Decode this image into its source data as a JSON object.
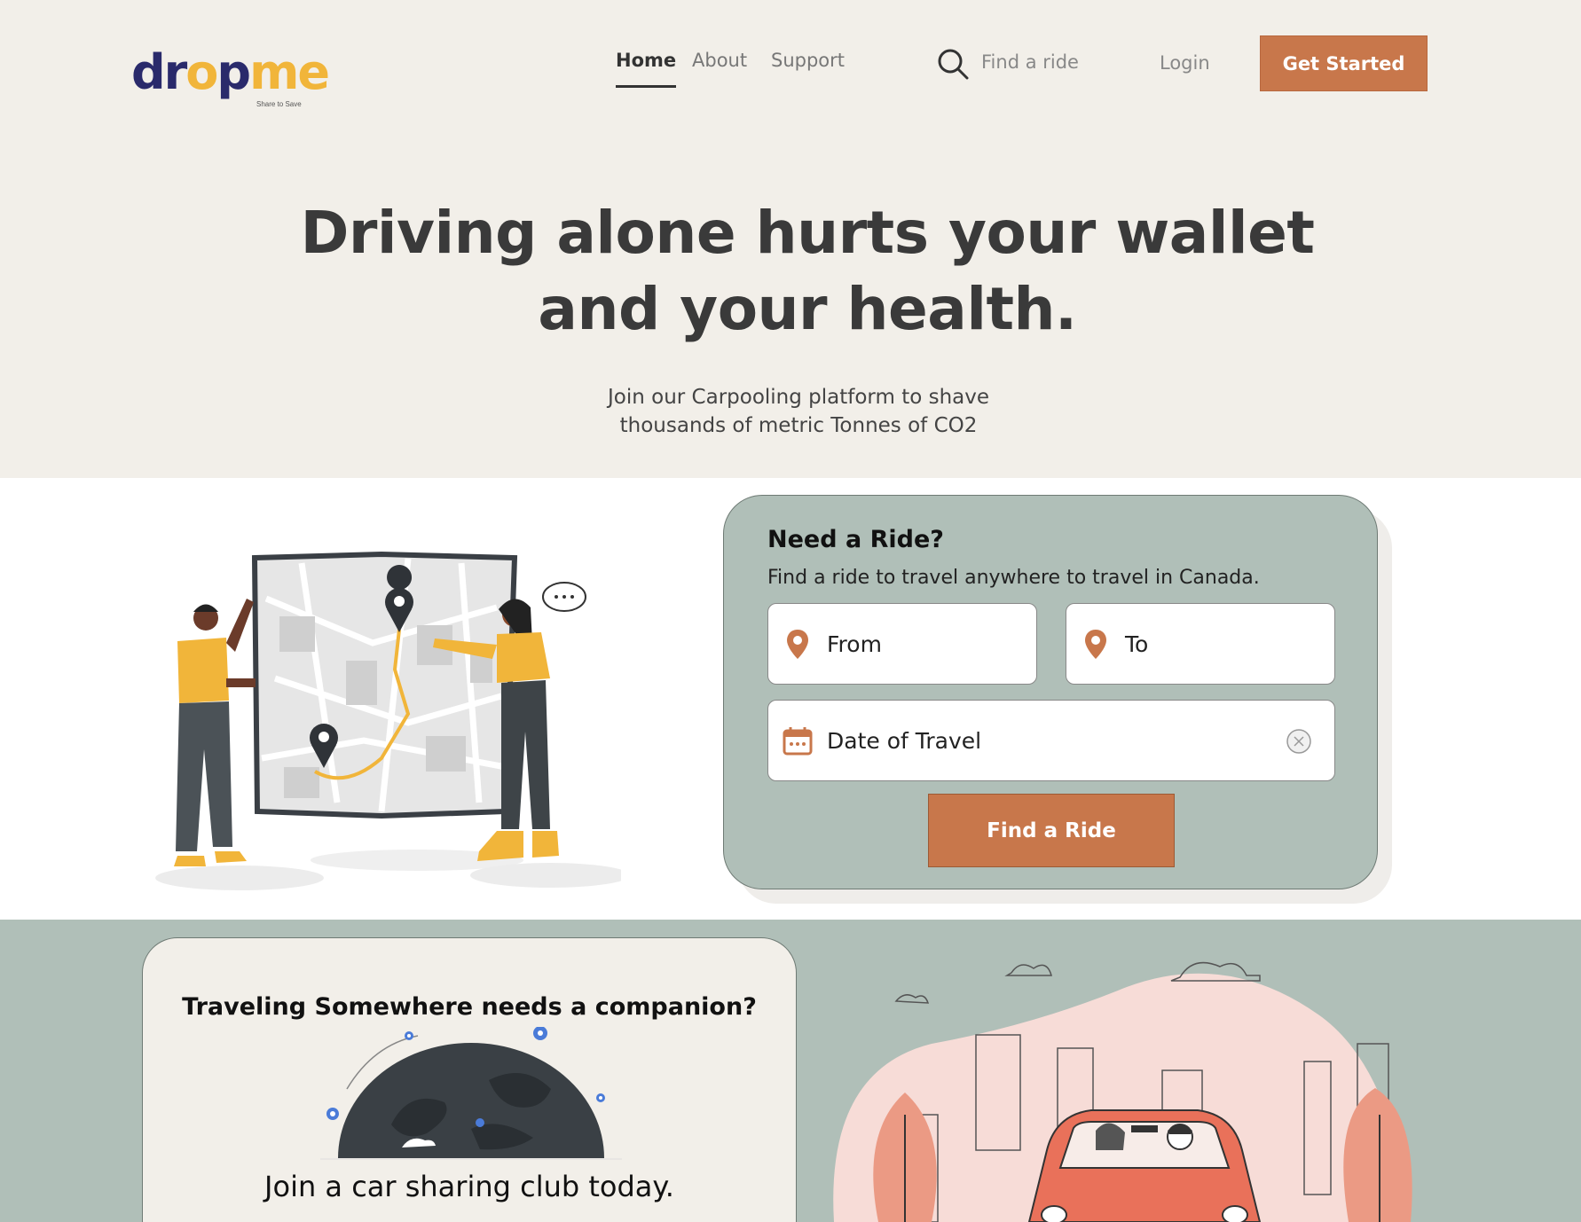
{
  "brand": {
    "logo_main": "dr",
    "logo_o": "o",
    "logo_p": "p",
    "logo_me": "me",
    "tagline": "Share to Save"
  },
  "nav": {
    "items": [
      "Home",
      "About",
      "Support"
    ],
    "active": "Home"
  },
  "header": {
    "search_label": "Find a ride",
    "login_label": "Login",
    "cta_label": "Get Started"
  },
  "hero": {
    "headline_line1": "Driving alone hurts your wallet",
    "headline_line2": "and your health.",
    "sub_line1": "Join our Carpooling platform to shave",
    "sub_line2": "thousands of metric Tonnes of CO2"
  },
  "ride_card": {
    "title": "Need a Ride?",
    "description": "Find a ride to travel anywhere to travel in Canada.",
    "from_placeholder": "From",
    "to_placeholder": "To",
    "date_placeholder": "Date of Travel",
    "button_label": "Find a Ride"
  },
  "companion_card": {
    "title": "Traveling Somewhere needs a companion?",
    "subtitle": "Join a car sharing club today."
  },
  "colors": {
    "accent": "#c8774b",
    "hero_bg": "#f2efe9",
    "sage": "#b0bfb8",
    "logo_navy": "#2a2a6b",
    "logo_yellow": "#f1b53a"
  }
}
